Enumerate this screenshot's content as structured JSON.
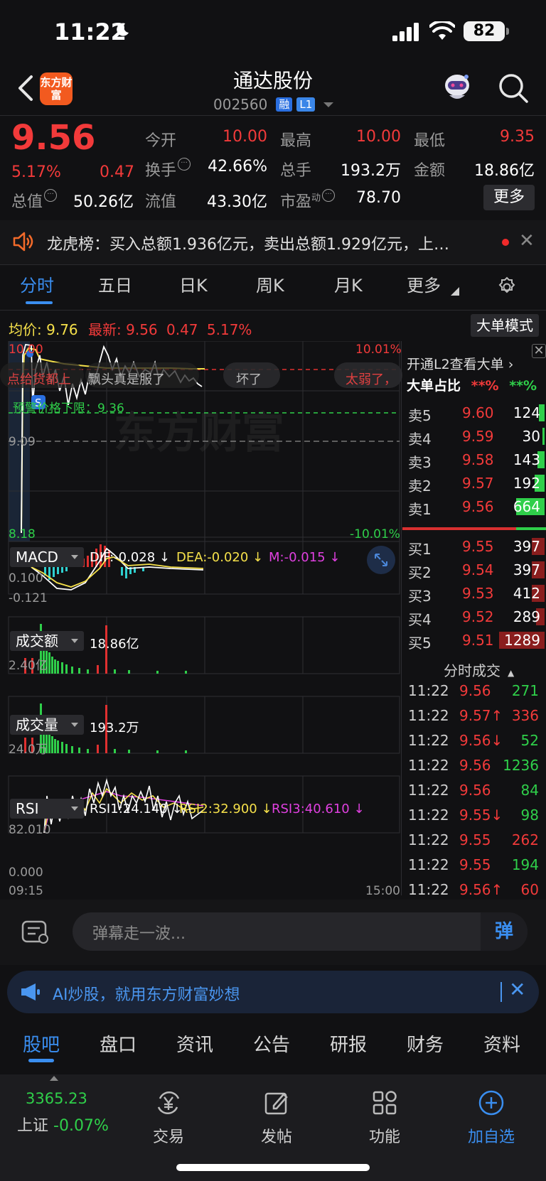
{
  "status": {
    "time": "11:22",
    "battery": "82"
  },
  "header": {
    "logo": "东方财富",
    "name": "通达股份",
    "code": "002560",
    "tags": [
      "融",
      "L1"
    ]
  },
  "quote": {
    "price": "9.56",
    "pct": "5.17%",
    "change": "0.47",
    "fields": {
      "open_label": "今开",
      "open": "10.00",
      "high_label": "最高",
      "high": "10.00",
      "low_label": "最低",
      "low": "9.35",
      "turnover_label": "换手",
      "turnover": "42.66%",
      "volume_label": "总手",
      "volume": "193.2万",
      "amount_label": "金额",
      "amount": "18.86亿",
      "mcap_label": "总值",
      "mcap": "50.26亿",
      "float_label": "流值",
      "float": "43.30亿",
      "pe_label": "市盈",
      "pe_sup": "动",
      "pe": "78.70"
    },
    "more": "更多"
  },
  "ticker": {
    "text": "龙虎榜：买入总额1.936亿元，卖出总额1.929亿元，上…"
  },
  "chart_tabs": [
    "分时",
    "五日",
    "日K",
    "周K",
    "月K",
    "更多"
  ],
  "summary": {
    "avg_label": "均价:",
    "avg": "9.76",
    "latest_label": "最新:",
    "latest": "9.56",
    "latest_chg": "0.47",
    "latest_pct": "5.17%",
    "big_mode": "大单模式"
  },
  "intraday": {
    "top_left": "10.00",
    "top_right": "10.01%",
    "mid_left": "9.09",
    "bottom_left": "8.18",
    "bottom_right": "-10.01%",
    "lower_limit": "预警价格下限：9.36",
    "danmu": [
      "点给货都上",
      "飘头真是服了",
      "坏了",
      "太弱了，"
    ],
    "watermark": "东方财富"
  },
  "macd": {
    "name": "MACD",
    "dif": "DIF:-0.028 ↓",
    "dea": "DEA:-0.020 ↓",
    "m": "M:-0.015 ↓",
    "top": "0.100",
    "bottom": "-0.121"
  },
  "amount_ind": {
    "name": "成交额",
    "value": "18.86亿",
    "top": "2.40亿"
  },
  "volume_ind": {
    "name": "成交量",
    "value": "193.2万",
    "top": "24.0万"
  },
  "rsi": {
    "name": "RSI",
    "rsi1": "RSI1:24.140 ↓",
    "rsi2": "RSI2:32.900 ↓",
    "rsi3": "RSI3:40.610 ↓",
    "top": "82.010",
    "bottom": "0.000"
  },
  "time_axis": {
    "start": "09:15",
    "end": "15:00"
  },
  "orderbook": {
    "header": "开通L2查看大单 ›",
    "ratio_label": "大单占比",
    "ratio_buy": "**%",
    "ratio_sell": "**%",
    "asks": [
      {
        "label": "卖5",
        "price": "9.60",
        "vol": "124"
      },
      {
        "label": "卖4",
        "price": "9.59",
        "vol": "30"
      },
      {
        "label": "卖3",
        "price": "9.58",
        "vol": "143"
      },
      {
        "label": "卖2",
        "price": "9.57",
        "vol": "192"
      },
      {
        "label": "卖1",
        "price": "9.56",
        "vol": "664"
      }
    ],
    "bids": [
      {
        "label": "买1",
        "price": "9.55",
        "vol": "397"
      },
      {
        "label": "买2",
        "price": "9.54",
        "vol": "397"
      },
      {
        "label": "买3",
        "price": "9.53",
        "vol": "412"
      },
      {
        "label": "买4",
        "price": "9.52",
        "vol": "289"
      },
      {
        "label": "买5",
        "price": "9.51",
        "vol": "1289"
      }
    ],
    "ticks_title": "分时成交",
    "ticks": [
      {
        "t": "11:22",
        "p": "9.56",
        "v": "271"
      },
      {
        "t": "11:22",
        "p": "9.57↑",
        "v": "336"
      },
      {
        "t": "11:22",
        "p": "9.56↓",
        "v": "52"
      },
      {
        "t": "11:22",
        "p": "9.56",
        "v": "1236"
      },
      {
        "t": "11:22",
        "p": "9.56",
        "v": "84"
      },
      {
        "t": "11:22",
        "p": "9.55↓",
        "v": "98"
      },
      {
        "t": "11:22",
        "p": "9.55",
        "v": "262"
      },
      {
        "t": "11:22",
        "p": "9.55",
        "v": "194"
      },
      {
        "t": "11:22",
        "p": "9.56↑",
        "v": "60"
      }
    ]
  },
  "danmu_input": {
    "placeholder": "弹幕走一波...",
    "send": "弹"
  },
  "ai_banner": {
    "text": "AI炒股，就用东方财富妙想"
  },
  "bottom_tabs": [
    "股吧",
    "盘口",
    "资讯",
    "公告",
    "研报",
    "财务",
    "资料"
  ],
  "nav": {
    "index_value": "3365.23",
    "index_name": "上证",
    "index_pct": "-0.07%",
    "items": [
      "交易",
      "发帖",
      "功能",
      "加自选"
    ]
  },
  "colors": {
    "up": "#f23a3a",
    "down": "#2fcf4a",
    "accent": "#3a8ef0"
  }
}
